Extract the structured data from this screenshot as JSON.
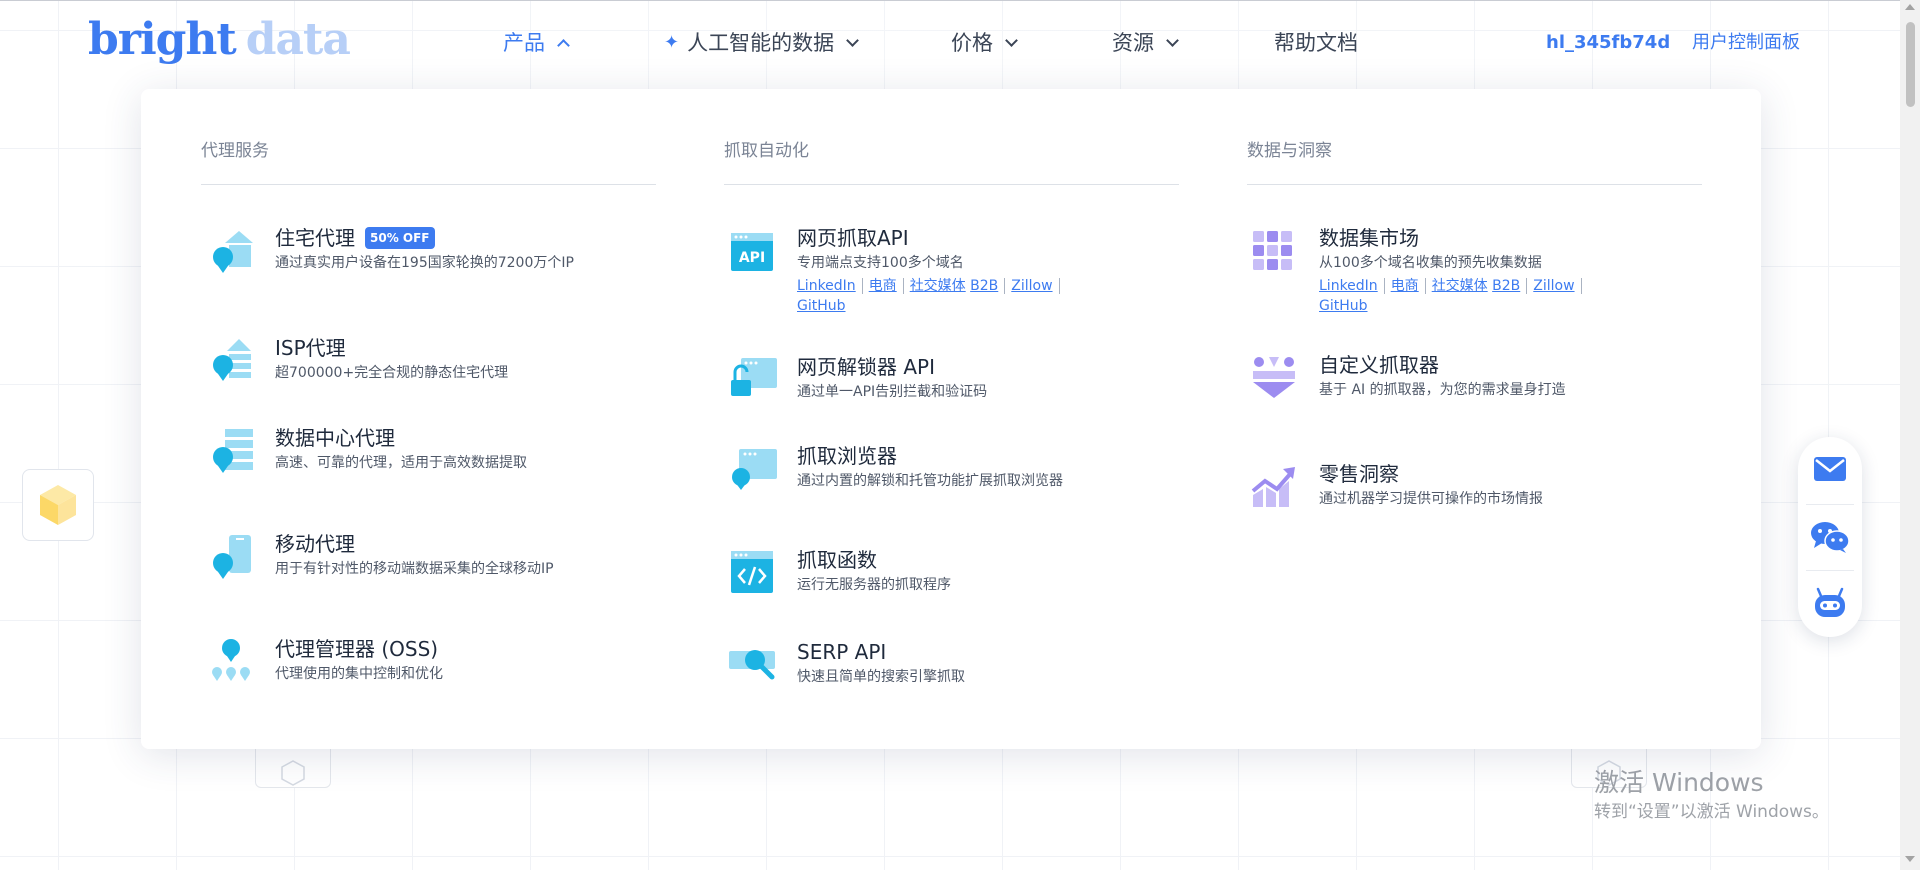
{
  "brand": {
    "part1": "bright",
    "part2": "data"
  },
  "nav": {
    "products": "产品",
    "ai_data": "人工智能的数据",
    "pricing": "价格",
    "resources": "资源",
    "docs": "帮助文档"
  },
  "user": {
    "id": "hl_345fb74d",
    "dashboard": "用户控制面板"
  },
  "columns": {
    "proxy": {
      "title": "代理服务",
      "items": [
        {
          "title": "住宅代理",
          "badge": "50% OFF",
          "desc": "通过真实用户设备在195国家轮换的7200万个IP",
          "icon": "residential-proxy-icon"
        },
        {
          "title": "ISP代理",
          "desc": "超700000+完全合规的静态住宅代理",
          "icon": "isp-proxy-icon"
        },
        {
          "title": "数据中心代理",
          "desc": "高速、可靠的代理，适用于高效数据提取",
          "icon": "datacenter-proxy-icon"
        },
        {
          "title": "移动代理",
          "desc": "用于有针对性的移动端数据采集的全球移动IP",
          "icon": "mobile-proxy-icon"
        },
        {
          "title": "代理管理器 (OSS)",
          "desc": "代理使用的集中控制和优化",
          "icon": "proxy-manager-icon"
        }
      ]
    },
    "automation": {
      "title": "抓取自动化",
      "items": [
        {
          "title": "网页抓取API",
          "desc": "专用端点支持100多个域名",
          "links": [
            "LinkedIn",
            "电商",
            "社交媒体",
            "B2B",
            "Zillow",
            "GitHub"
          ],
          "icon": "api-icon"
        },
        {
          "title": "网页解锁器 API",
          "desc": "通过单一API告别拦截和验证码",
          "icon": "unlocker-icon"
        },
        {
          "title": "抓取浏览器",
          "desc": "通过内置的解锁和托管功能扩展抓取浏览器",
          "icon": "scraping-browser-icon"
        },
        {
          "title": "抓取函数",
          "desc": "运行无服务器的抓取程序",
          "icon": "code-function-icon"
        },
        {
          "title": "SERP API",
          "desc": "快速且简单的搜索引擎抓取",
          "icon": "serp-search-icon"
        }
      ]
    },
    "insights": {
      "title": "数据与洞察",
      "items": [
        {
          "title": "数据集市场",
          "desc": "从100多个域名收集的预先收集数据",
          "links": [
            "LinkedIn",
            "电商",
            "社交媒体",
            "B2B",
            "Zillow",
            "GitHub"
          ],
          "icon": "dataset-grid-icon"
        },
        {
          "title": "自定义抓取器",
          "desc": "基于 AI 的抓取器，为您的需求量身打造",
          "icon": "custom-scraper-icon"
        },
        {
          "title": "零售洞察",
          "desc": "通过机器学习提供可操作的市场情报",
          "icon": "retail-chart-icon"
        }
      ]
    }
  },
  "watermark": {
    "line1": "激活 Windows",
    "line2": "转到“设置”以激活 Windows。"
  },
  "colors": {
    "accent": "#3d7bf0",
    "proxy_icon": "#35c0ea",
    "insight_icon": "#9c8cf0"
  }
}
